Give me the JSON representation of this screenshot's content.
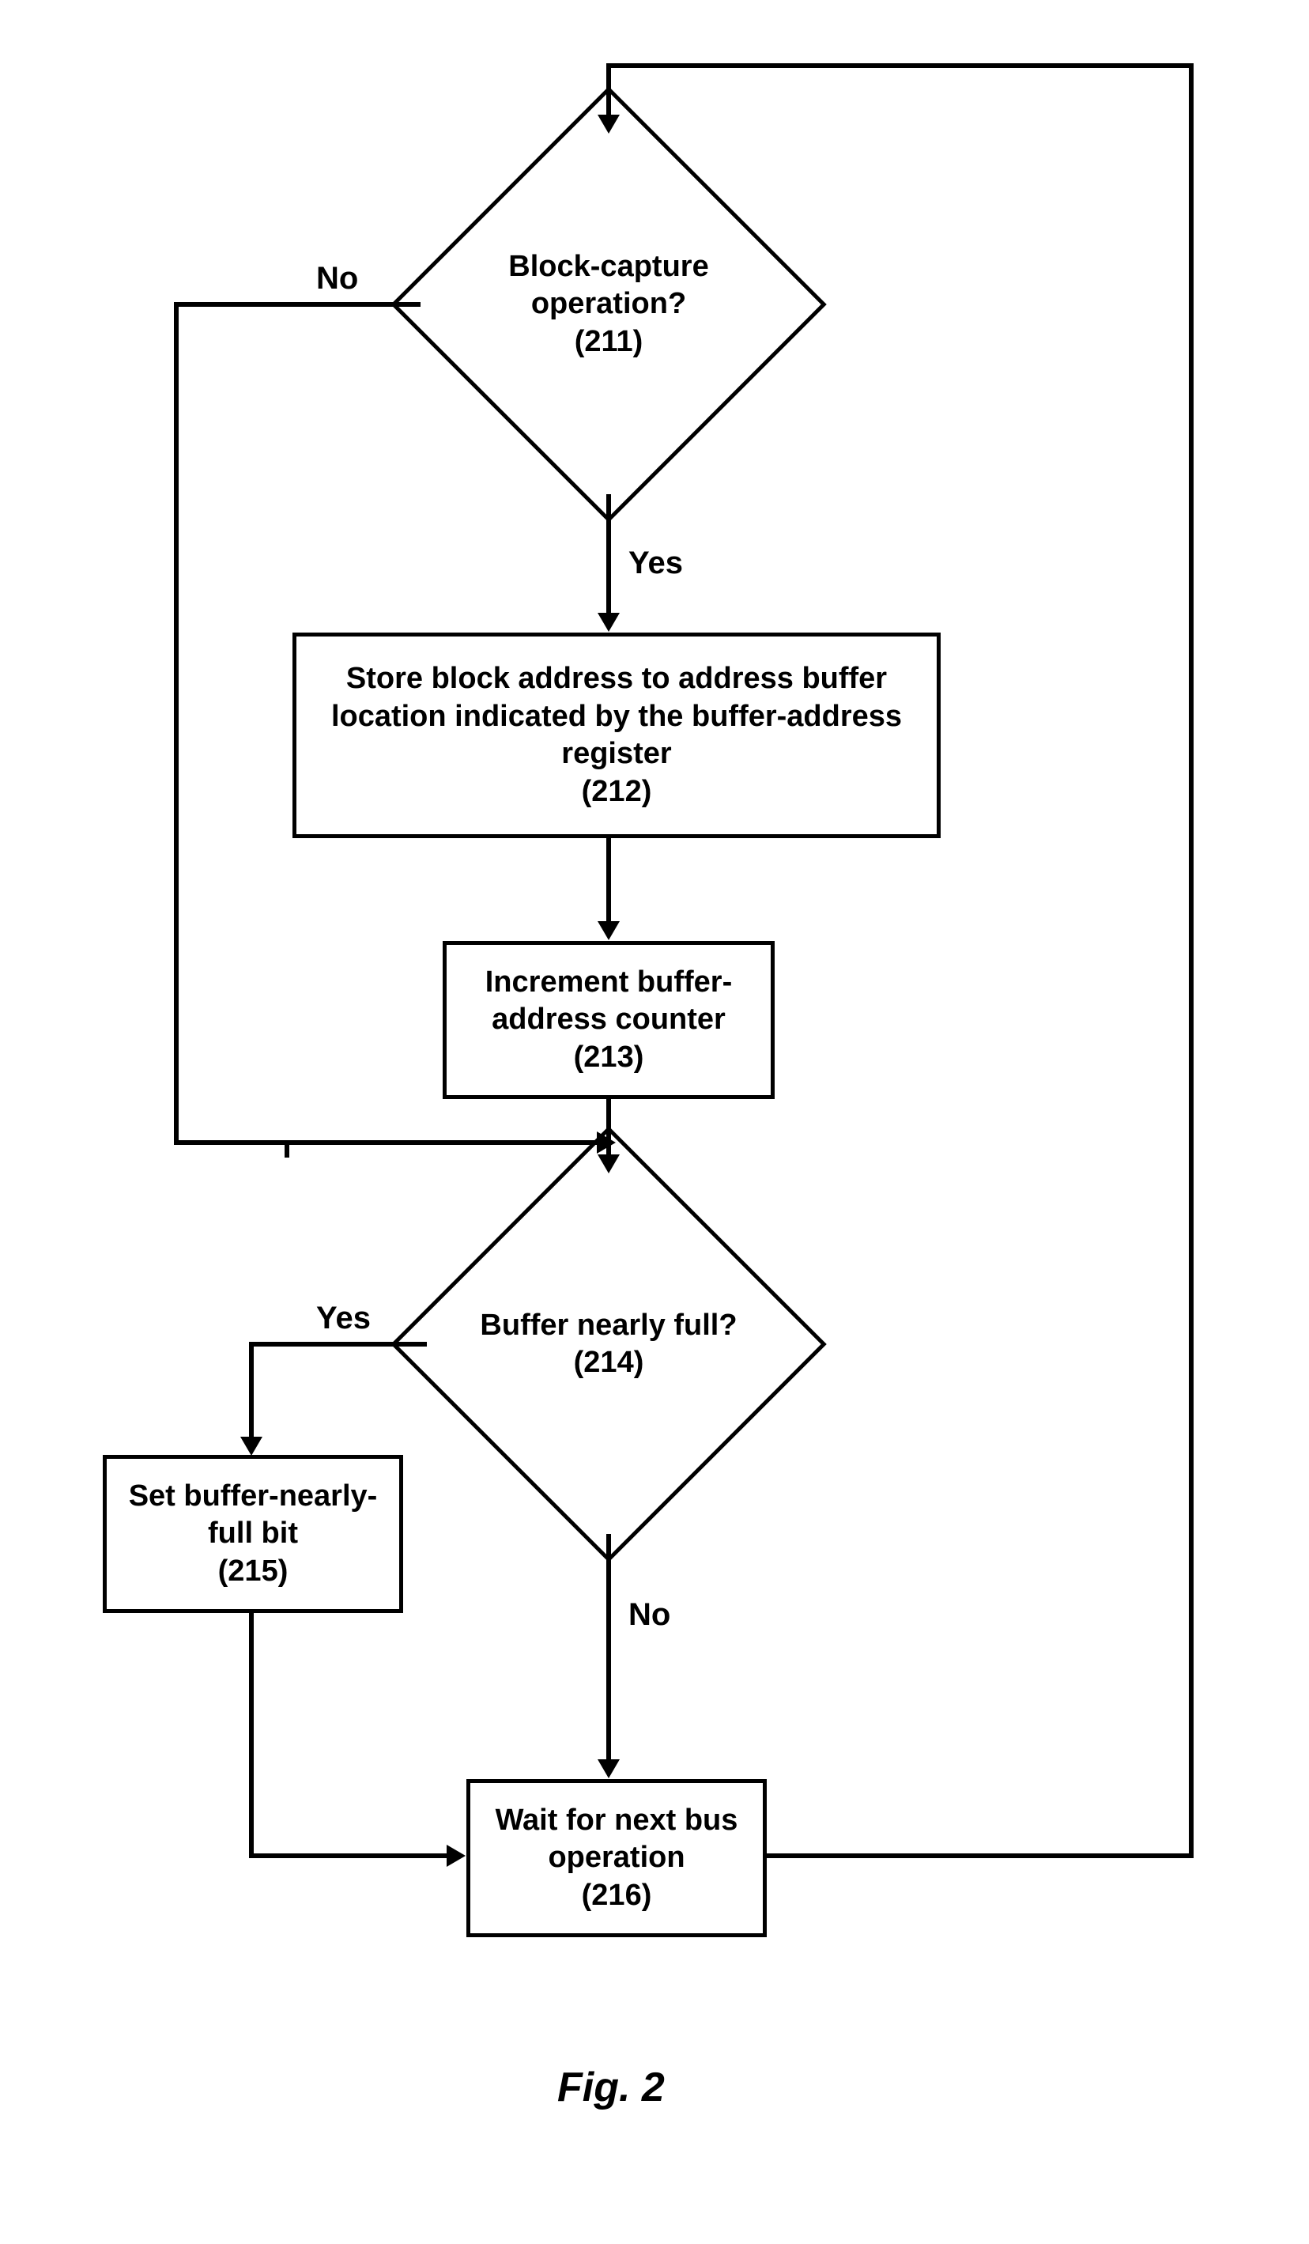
{
  "figure_caption": "Fig. 2",
  "chart_data": {
    "type": "flowchart",
    "nodes": [
      {
        "id": "211",
        "kind": "decision",
        "text": "Block-capture operation?",
        "ref": "(211)"
      },
      {
        "id": "212",
        "kind": "process",
        "text": "Store block address to address buffer location indicated by the buffer-address register",
        "ref": "(212)"
      },
      {
        "id": "213",
        "kind": "process",
        "text": "Increment buffer-address counter",
        "ref": "(213)"
      },
      {
        "id": "214",
        "kind": "decision",
        "text": "Buffer nearly full?",
        "ref": "(214)"
      },
      {
        "id": "215",
        "kind": "process",
        "text": "Set buffer-nearly-full bit",
        "ref": "(215)"
      },
      {
        "id": "216",
        "kind": "process",
        "text": "Wait for next bus operation",
        "ref": "(216)"
      }
    ],
    "edges": [
      {
        "from": "211",
        "to": "212",
        "label": "Yes"
      },
      {
        "from": "211",
        "to": "214",
        "label": "No",
        "note": "bypass via left side to join above 214"
      },
      {
        "from": "212",
        "to": "213"
      },
      {
        "from": "213",
        "to": "214"
      },
      {
        "from": "214",
        "to": "215",
        "label": "Yes"
      },
      {
        "from": "214",
        "to": "216",
        "label": "No"
      },
      {
        "from": "215",
        "to": "216"
      },
      {
        "from": "216",
        "to": "211",
        "label": "",
        "note": "loop back via right side"
      }
    ],
    "labels": {
      "yes": "Yes",
      "no": "No"
    }
  }
}
